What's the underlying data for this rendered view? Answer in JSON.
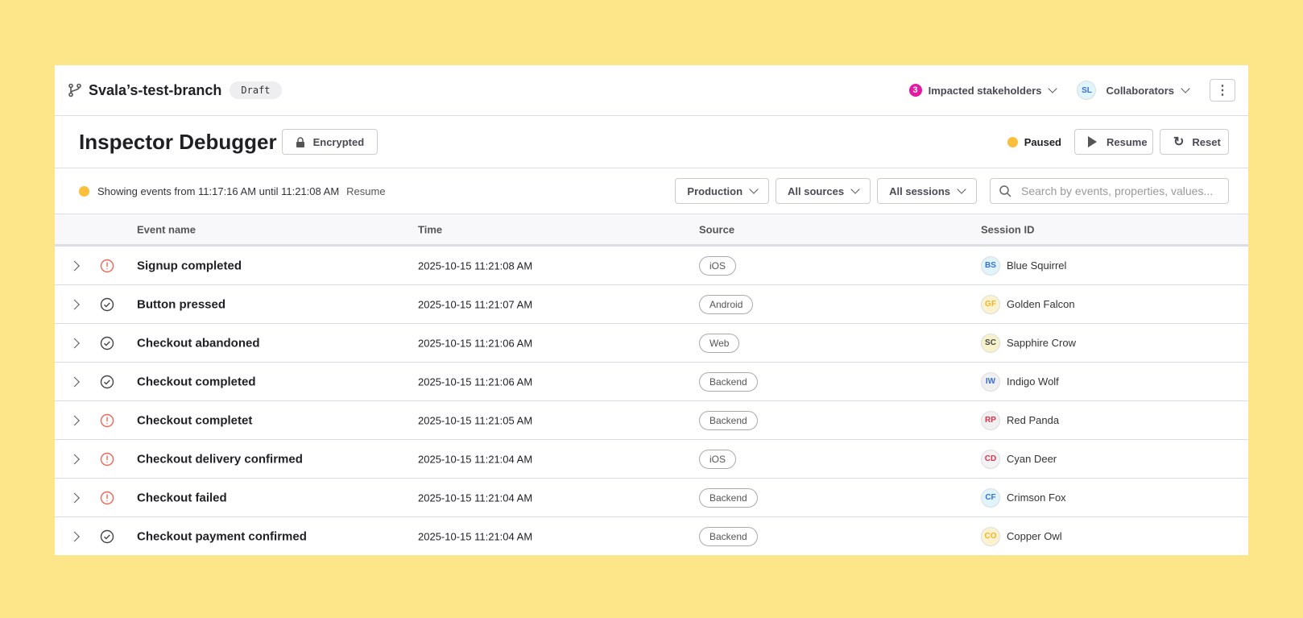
{
  "header": {
    "branch": "Svala’s-test-branch",
    "status": "Draft",
    "stakeholders_count": "3",
    "stakeholders_label": "Impacted stakeholders",
    "collaborator_initials": "SL",
    "collaborators_label": "Collaborators",
    "more": "⋮"
  },
  "page": {
    "title": "Inspector Debugger",
    "encrypted_label": "Encrypted",
    "state": "Paused",
    "resume_label": "Resume",
    "reset_label": "Reset"
  },
  "filters": {
    "range_text": "Showing events from 11:17:16 AM until 11:21:08 AM",
    "resume_link": "Resume",
    "environment": "Production",
    "sources": "All sources",
    "sessions": "All sessions",
    "search_placeholder": "Search by events, properties, values..."
  },
  "table": {
    "columns": [
      "Event name",
      "Time",
      "Source",
      "Session ID"
    ],
    "rows": [
      {
        "status": "error",
        "event": "Signup completed",
        "time": "2025-10-15 11:21:08 AM",
        "source": "iOS",
        "initials": "BS",
        "session": "Blue Squirrel",
        "color": "#3b6fd6",
        "bg": "#e0f4fb"
      },
      {
        "status": "ok",
        "event": "Button pressed",
        "time": "2025-10-15 11:21:07 AM",
        "source": "Android",
        "initials": "GF",
        "session": "Golden Falcon",
        "color": "#f0b429",
        "bg": "#fbf3cf"
      },
      {
        "status": "ok",
        "event": "Checkout abandoned",
        "time": "2025-10-15 11:21:06 AM",
        "source": "Web",
        "initials": "SC",
        "session": "Sapphire Crow",
        "color": "#444",
        "bg": "#f8f2cc"
      },
      {
        "status": "ok",
        "event": "Checkout completed",
        "time": "2025-10-15 11:21:06 AM",
        "source": "Backend",
        "initials": "IW",
        "session": "Indigo Wolf",
        "color": "#3b6fd6",
        "bg": "#f0f0f3"
      },
      {
        "status": "error",
        "event": "Checkout completet",
        "time": "2025-10-15 11:21:05 AM",
        "source": "Backend",
        "initials": "RP",
        "session": "Red Panda",
        "color": "#e0314b",
        "bg": "#f0f0f3"
      },
      {
        "status": "error",
        "event": "Checkout delivery confirmed",
        "time": "2025-10-15 11:21:04 AM",
        "source": "iOS",
        "initials": "CD",
        "session": "Cyan Deer",
        "color": "#e0314b",
        "bg": "#f3f3f5"
      },
      {
        "status": "error",
        "event": "Checkout failed",
        "time": "2025-10-15 11:21:04 AM",
        "source": "Backend",
        "initials": "CF",
        "session": "Crimson Fox",
        "color": "#3b6fd6",
        "bg": "#e0f4fb"
      },
      {
        "status": "ok",
        "event": "Checkout payment confirmed",
        "time": "2025-10-15 11:21:04 AM",
        "source": "Backend",
        "initials": "CO",
        "session": "Copper Owl",
        "color": "#f0b429",
        "bg": "#fbf3cf"
      }
    ]
  },
  "colors": {
    "background": "#fde68a",
    "paused": "#fbbf3c",
    "error": "#f0645a",
    "badge": "#e619a4"
  }
}
